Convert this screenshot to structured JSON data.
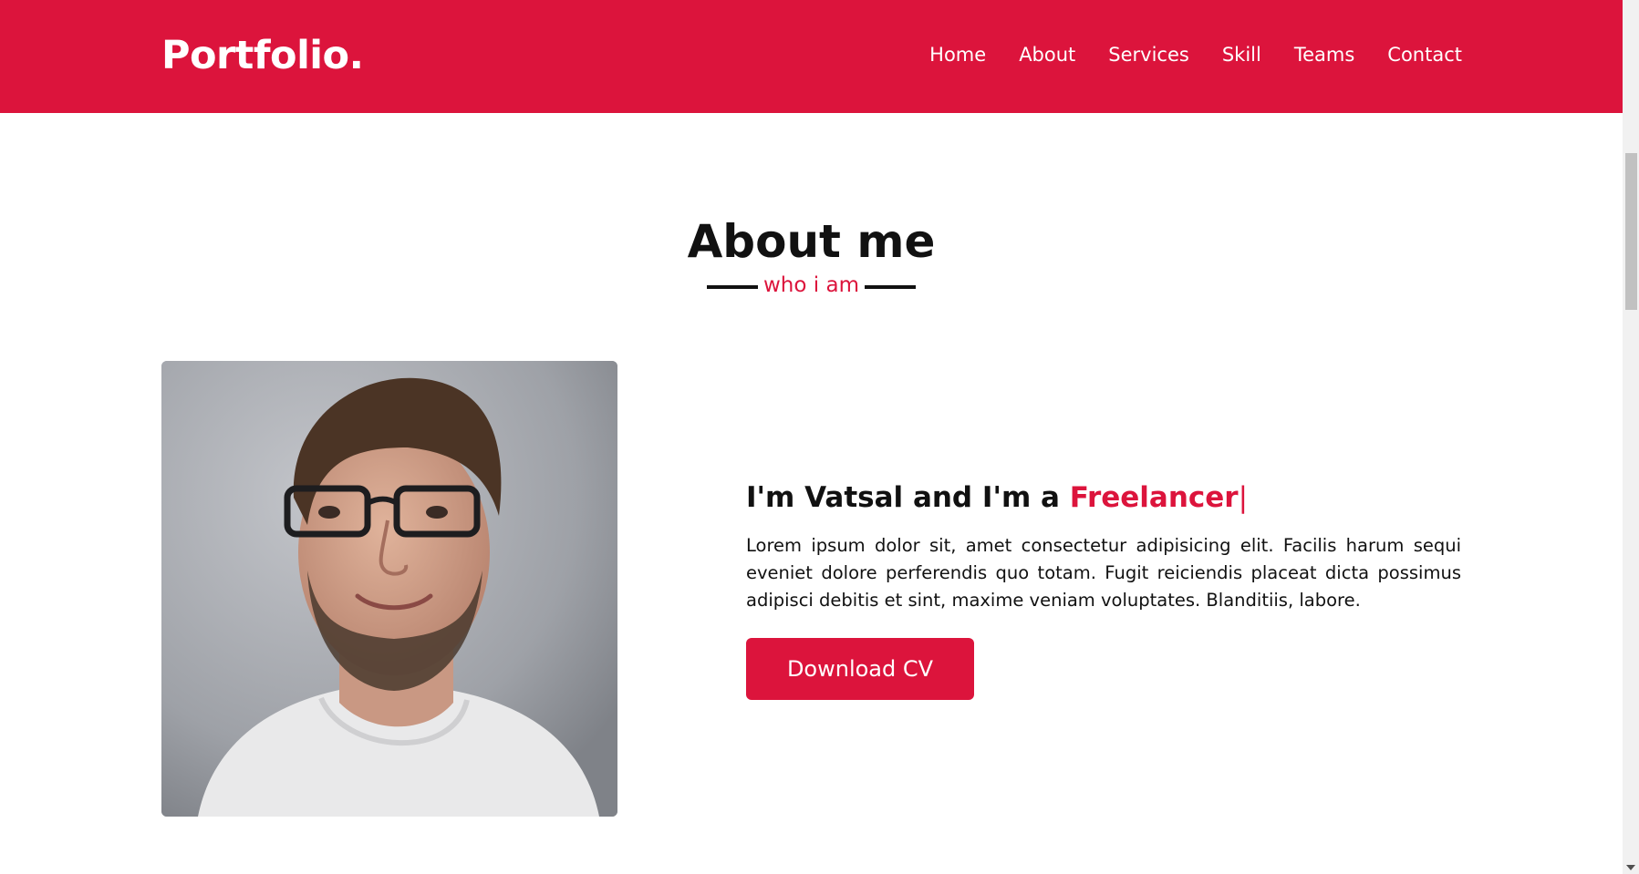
{
  "navbar": {
    "logo": "Portfolio.",
    "links": [
      "Home",
      "About",
      "Services",
      "Skill",
      "Teams",
      "Contact"
    ]
  },
  "about": {
    "title": "About me",
    "subtitle": "who i am",
    "headline_prefix": "I'm Vatsal and I'm a ",
    "headline_role": "Freelancer",
    "headline_cursor": "|",
    "paragraph": "Lorem ipsum dolor sit, amet consectetur adipisicing elit. Facilis harum sequi eveniet dolore perferendis quo totam. Fugit reiciendis placeat dicta possimus adipisci debitis et sint, maxime veniam voluptates. Blanditiis, labore.",
    "button_label": "Download CV"
  },
  "colors": {
    "accent": "#dc143c",
    "text": "#111111",
    "background": "#ffffff"
  },
  "icons": {
    "scroll_down": "scroll-down-arrow-icon"
  }
}
